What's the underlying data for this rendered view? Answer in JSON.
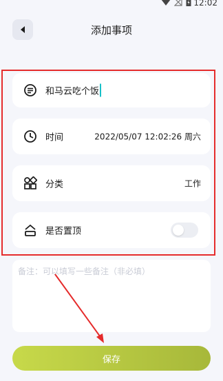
{
  "status_bar": {
    "time": "12:02",
    "icons": [
      "wifi-icon",
      "no-signal-icon",
      "battery-charging-icon"
    ]
  },
  "header": {
    "title": "添加事项",
    "back_icon": "back-arrow-icon"
  },
  "form": {
    "title_value": "和马云吃个饭",
    "time": {
      "label": "时间",
      "value": "2022/05/07 12:02:26 周六"
    },
    "category": {
      "label": "分类",
      "value": "工作"
    },
    "pin": {
      "label": "是否置顶",
      "enabled": false
    }
  },
  "notes": {
    "placeholder": "备注：可以填写一些备注（非必填）"
  },
  "save_button": {
    "label": "保存"
  },
  "colors": {
    "highlight": "#e52b2b",
    "save_gradient_start": "#c7d94a",
    "save_gradient_end": "#a7b83a",
    "cursor": "#17c0c8"
  }
}
